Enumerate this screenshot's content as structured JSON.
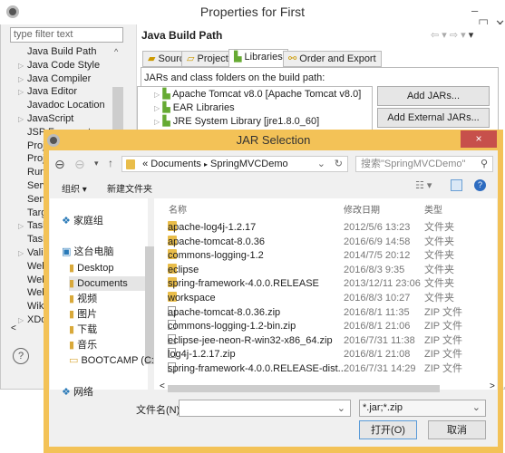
{
  "outer": {
    "title": "Properties for First",
    "filter_placeholder": "type filter text",
    "tree": [
      {
        "label": "Java Build Path",
        "arrow": false
      },
      {
        "label": "Java Code Style",
        "arrow": true
      },
      {
        "label": "Java Compiler",
        "arrow": true
      },
      {
        "label": "Java Editor",
        "arrow": true
      },
      {
        "label": "Javadoc Location",
        "arrow": false
      },
      {
        "label": "JavaScript",
        "arrow": true
      },
      {
        "label": "JSP Fragment",
        "arrow": false
      },
      {
        "label": "Proj",
        "arrow": false
      },
      {
        "label": "Proj",
        "arrow": false
      },
      {
        "label": "Run/",
        "arrow": false
      },
      {
        "label": "Serv",
        "arrow": false
      },
      {
        "label": "Serv",
        "arrow": false
      },
      {
        "label": "Targ",
        "arrow": false
      },
      {
        "label": "Task",
        "arrow": true
      },
      {
        "label": "Task",
        "arrow": false
      },
      {
        "label": "Vali",
        "arrow": true
      },
      {
        "label": "Web",
        "arrow": false
      },
      {
        "label": "Web",
        "arrow": false
      },
      {
        "label": "Web",
        "arrow": false
      },
      {
        "label": "Wiki",
        "arrow": false
      },
      {
        "label": "XDo",
        "arrow": true
      }
    ],
    "page_title": "Java Build Path",
    "tabs": [
      "Source",
      "Projects",
      "Libraries",
      "Order and Export"
    ],
    "active_tab": "Libraries",
    "build_path_label": "JARs and class folders on the build path:",
    "libraries": [
      "Apache Tomcat v8.0 [Apache Tomcat v8.0]",
      "EAR Libraries",
      "JRE System Library [jre1.8.0_60]"
    ],
    "buttons": {
      "add_jars": "Add JARs...",
      "add_external_jars": "Add External JARs..."
    },
    "help": "?"
  },
  "jar": {
    "title": "JAR Selection",
    "close": "×",
    "breadcrumb": [
      "«",
      "Documents",
      "▸",
      "SpringMVCDemo"
    ],
    "search_placeholder": "搜索\"SpringMVCDemo\"",
    "organize": "组织 ▾",
    "new_folder": "新建文件夹",
    "nav": [
      {
        "label": "家庭组",
        "indent": 0
      },
      {
        "label": "这台电脑",
        "indent": 0
      },
      {
        "label": "Desktop",
        "indent": 1
      },
      {
        "label": "Documents",
        "indent": 1,
        "selected": true
      },
      {
        "label": "视频",
        "indent": 1
      },
      {
        "label": "图片",
        "indent": 1
      },
      {
        "label": "下载",
        "indent": 1
      },
      {
        "label": "音乐",
        "indent": 1
      },
      {
        "label": "BOOTCAMP (C:",
        "indent": 1
      },
      {
        "label": "网络",
        "indent": 0
      }
    ],
    "columns": [
      "名称",
      "修改日期",
      "类型"
    ],
    "files": [
      {
        "name": "apache-log4j-1.2.17",
        "date": "2012/5/6 13:23",
        "type": "文件夹",
        "kind": "folder"
      },
      {
        "name": "apache-tomcat-8.0.36",
        "date": "2016/6/9 14:58",
        "type": "文件夹",
        "kind": "folder"
      },
      {
        "name": "commons-logging-1.2",
        "date": "2014/7/5 20:12",
        "type": "文件夹",
        "kind": "folder"
      },
      {
        "name": "eclipse",
        "date": "2016/8/3 9:35",
        "type": "文件夹",
        "kind": "folder"
      },
      {
        "name": "spring-framework-4.0.0.RELEASE",
        "date": "2013/12/11 23:06",
        "type": "文件夹",
        "kind": "folder"
      },
      {
        "name": "workspace",
        "date": "2016/8/3 10:27",
        "type": "文件夹",
        "kind": "folder"
      },
      {
        "name": "apache-tomcat-8.0.36.zip",
        "date": "2016/8/1 11:35",
        "type": "ZIP 文件",
        "kind": "zip"
      },
      {
        "name": "commons-logging-1.2-bin.zip",
        "date": "2016/8/1 21:06",
        "type": "ZIP 文件",
        "kind": "zip"
      },
      {
        "name": "eclipse-jee-neon-R-win32-x86_64.zip",
        "date": "2016/7/31 11:38",
        "type": "ZIP 文件",
        "kind": "zip"
      },
      {
        "name": "log4j-1.2.17.zip",
        "date": "2016/8/1 21:08",
        "type": "ZIP 文件",
        "kind": "zip"
      },
      {
        "name": "spring-framework-4.0.0.RELEASE-dist...",
        "date": "2016/7/31 14:29",
        "type": "ZIP 文件",
        "kind": "zip"
      }
    ],
    "filename_label": "文件名(N):",
    "filename_value": "",
    "filetype": "*.jar;*.zip",
    "open": "打开(O)",
    "cancel": "取消"
  },
  "colors": {
    "jar_border": "#f3c257",
    "close": "#c7504b"
  }
}
